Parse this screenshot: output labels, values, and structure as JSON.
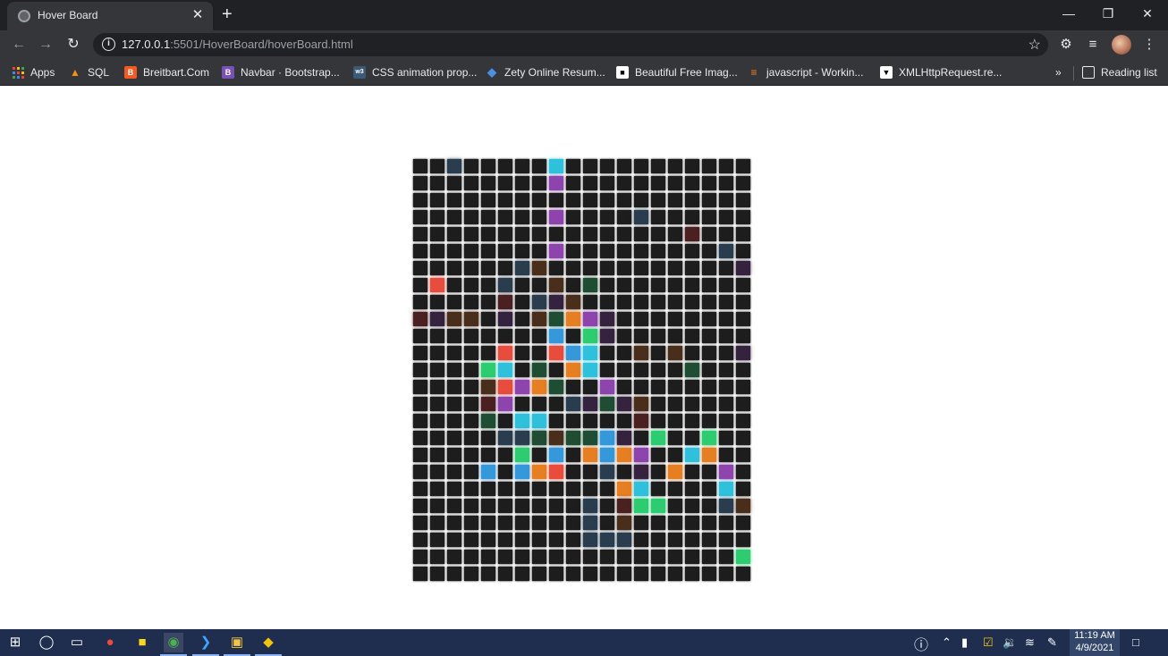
{
  "browser": {
    "tab": {
      "title": "Hover Board",
      "close": "✕"
    },
    "new_tab": "+",
    "window": {
      "minimize": "—",
      "restore": "❐",
      "close": "✕"
    },
    "url": {
      "host": "127.0.0.1",
      "path": ":5501/HoverBoard/hoverBoard.html"
    },
    "bookmarks": [
      {
        "label": "Apps",
        "icon": "apps-grid-icon",
        "color": "#e8eaed"
      },
      {
        "label": "SQL",
        "icon": "sql-icon",
        "color": "#f29111"
      },
      {
        "label": "Breitbart.Com",
        "icon": "breitbart-icon",
        "color": "#f15a22"
      },
      {
        "label": "Navbar · Bootstrap...",
        "icon": "bootstrap-icon",
        "color": "#7952b3"
      },
      {
        "label": "CSS animation prop...",
        "icon": "w3schools-icon",
        "color": "#3a5a78"
      },
      {
        "label": "Zety Online Resum...",
        "icon": "zety-icon",
        "color": "#4a90e2"
      },
      {
        "label": "Beautiful Free Imag...",
        "icon": "unsplash-icon",
        "color": "#ffffff"
      },
      {
        "label": "javascript - Workin...",
        "icon": "stackoverflow-icon",
        "color": "#f48024"
      },
      {
        "label": "XMLHttpRequest.re...",
        "icon": "mdn-icon",
        "color": "#ffffff"
      }
    ],
    "bookmarks_overflow": "»",
    "reading_list": "Reading list"
  },
  "board": {
    "rows": 25,
    "cols": 20,
    "default_color": "#1d1d1d",
    "lit": [
      [
        0,
        2,
        "#2a3d4f"
      ],
      [
        0,
        8,
        "#2fc1dc"
      ],
      [
        1,
        8,
        "#8e44ad"
      ],
      [
        3,
        8,
        "#8e44ad"
      ],
      [
        3,
        13,
        "#2a3d4f"
      ],
      [
        4,
        16,
        "#4a2020"
      ],
      [
        5,
        8,
        "#8e44ad"
      ],
      [
        5,
        18,
        "#2a3d4f"
      ],
      [
        6,
        6,
        "#2a3d4f"
      ],
      [
        6,
        7,
        "#4a2e1c"
      ],
      [
        6,
        19,
        "#35223f"
      ],
      [
        7,
        1,
        "#e74c3c"
      ],
      [
        7,
        5,
        "#2a3d4f"
      ],
      [
        7,
        8,
        "#4a2e1c"
      ],
      [
        7,
        10,
        "#1e4d33"
      ],
      [
        8,
        5,
        "#4a2020"
      ],
      [
        8,
        7,
        "#2a3d4f"
      ],
      [
        8,
        8,
        "#35223f"
      ],
      [
        8,
        9,
        "#4a2e1c"
      ],
      [
        9,
        0,
        "#4a2020"
      ],
      [
        9,
        1,
        "#35223f"
      ],
      [
        9,
        2,
        "#4a2e1c"
      ],
      [
        9,
        3,
        "#4a2e1c"
      ],
      [
        9,
        5,
        "#35223f"
      ],
      [
        9,
        7,
        "#4a2e1c"
      ],
      [
        9,
        8,
        "#1e4d33"
      ],
      [
        9,
        9,
        "#e67e22"
      ],
      [
        9,
        10,
        "#8e44ad"
      ],
      [
        9,
        11,
        "#35223f"
      ],
      [
        10,
        8,
        "#3498db"
      ],
      [
        10,
        10,
        "#2ecc71"
      ],
      [
        10,
        11,
        "#35223f"
      ],
      [
        11,
        5,
        "#e74c3c"
      ],
      [
        11,
        8,
        "#e74c3c"
      ],
      [
        11,
        9,
        "#3498db"
      ],
      [
        11,
        10,
        "#2fc1dc"
      ],
      [
        11,
        13,
        "#4a2e1c"
      ],
      [
        11,
        15,
        "#4a2e1c"
      ],
      [
        11,
        19,
        "#35223f"
      ],
      [
        12,
        4,
        "#2ecc71"
      ],
      [
        12,
        5,
        "#2fc1dc"
      ],
      [
        12,
        7,
        "#1e4d33"
      ],
      [
        12,
        9,
        "#e67e22"
      ],
      [
        12,
        10,
        "#2fc1dc"
      ],
      [
        12,
        16,
        "#1e4d33"
      ],
      [
        13,
        4,
        "#4a2e1c"
      ],
      [
        13,
        5,
        "#e74c3c"
      ],
      [
        13,
        6,
        "#8e44ad"
      ],
      [
        13,
        7,
        "#e67e22"
      ],
      [
        13,
        8,
        "#1e4d33"
      ],
      [
        13,
        11,
        "#8e44ad"
      ],
      [
        14,
        4,
        "#4a2020"
      ],
      [
        14,
        5,
        "#8e44ad"
      ],
      [
        14,
        9,
        "#2a3d4f"
      ],
      [
        14,
        10,
        "#35223f"
      ],
      [
        14,
        11,
        "#1e4d33"
      ],
      [
        14,
        12,
        "#35223f"
      ],
      [
        14,
        13,
        "#4a2e1c"
      ],
      [
        15,
        4,
        "#1e4d33"
      ],
      [
        15,
        6,
        "#2fc1dc"
      ],
      [
        15,
        7,
        "#2fc1dc"
      ],
      [
        15,
        13,
        "#4a2020"
      ],
      [
        16,
        5,
        "#2a3d4f"
      ],
      [
        16,
        6,
        "#2a3d4f"
      ],
      [
        16,
        7,
        "#1e4d33"
      ],
      [
        16,
        8,
        "#4a2e1c"
      ],
      [
        16,
        9,
        "#1e4d33"
      ],
      [
        16,
        10,
        "#1e4d33"
      ],
      [
        16,
        11,
        "#3498db"
      ],
      [
        16,
        12,
        "#35223f"
      ],
      [
        16,
        14,
        "#2ecc71"
      ],
      [
        16,
        17,
        "#2ecc71"
      ],
      [
        17,
        6,
        "#2ecc71"
      ],
      [
        17,
        8,
        "#3498db"
      ],
      [
        17,
        10,
        "#e67e22"
      ],
      [
        17,
        11,
        "#3498db"
      ],
      [
        17,
        12,
        "#e67e22"
      ],
      [
        17,
        13,
        "#8e44ad"
      ],
      [
        17,
        16,
        "#2fc1dc"
      ],
      [
        17,
        17,
        "#e67e22"
      ],
      [
        18,
        4,
        "#3498db"
      ],
      [
        18,
        6,
        "#3498db"
      ],
      [
        18,
        7,
        "#e67e22"
      ],
      [
        18,
        8,
        "#e74c3c"
      ],
      [
        18,
        11,
        "#2a3d4f"
      ],
      [
        18,
        13,
        "#35223f"
      ],
      [
        18,
        15,
        "#e67e22"
      ],
      [
        18,
        18,
        "#8e44ad"
      ],
      [
        19,
        12,
        "#e67e22"
      ],
      [
        19,
        13,
        "#2fc1dc"
      ],
      [
        19,
        18,
        "#2fc1dc"
      ],
      [
        20,
        10,
        "#2a3d4f"
      ],
      [
        20,
        12,
        "#4a2020"
      ],
      [
        20,
        13,
        "#2ecc71"
      ],
      [
        20,
        14,
        "#2ecc71"
      ],
      [
        20,
        18,
        "#2a3d4f"
      ],
      [
        20,
        19,
        "#4a2e1c"
      ],
      [
        21,
        10,
        "#2a3d4f"
      ],
      [
        21,
        12,
        "#4a2e1c"
      ],
      [
        22,
        10,
        "#2a3d4f"
      ],
      [
        22,
        11,
        "#2a3d4f"
      ],
      [
        22,
        12,
        "#2a3d4f"
      ],
      [
        23,
        19,
        "#2ecc71"
      ]
    ]
  },
  "taskbar": {
    "clock": {
      "time": "11:19 AM",
      "date": "4/9/2021"
    }
  }
}
